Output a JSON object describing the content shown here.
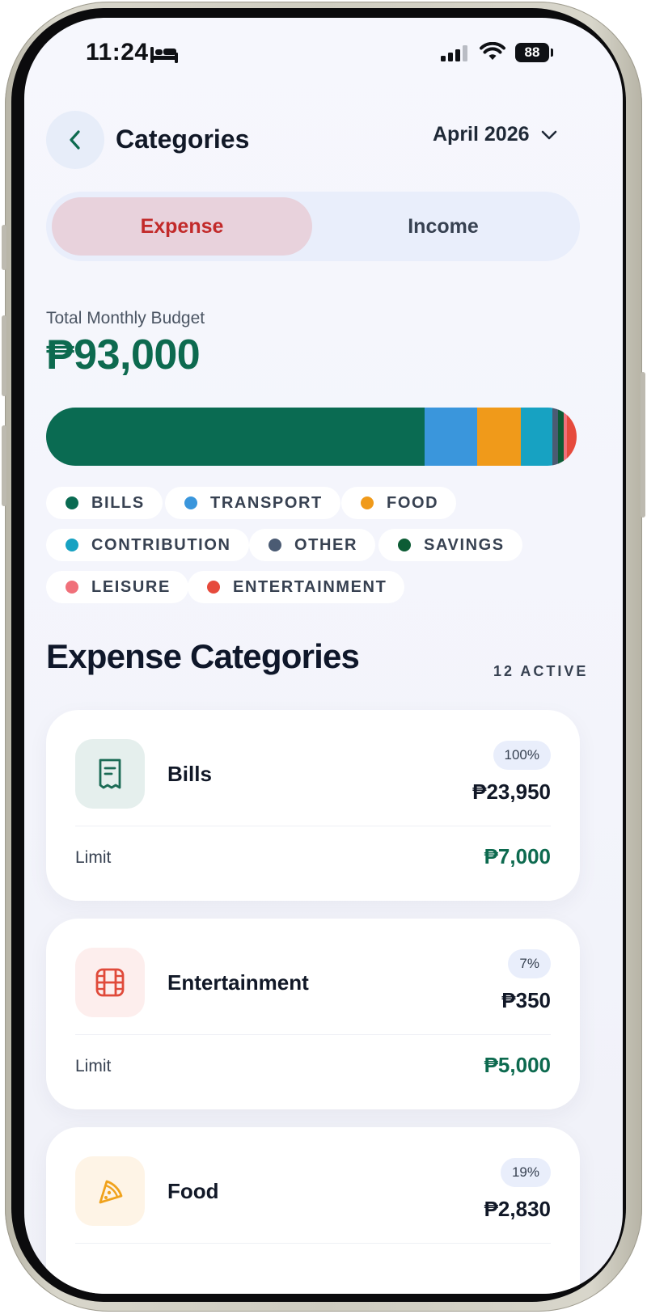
{
  "status_bar": {
    "time": "11:24",
    "battery": "88"
  },
  "header": {
    "title": "Categories",
    "month": "April 2026"
  },
  "toggle": {
    "expense_label": "Expense",
    "income_label": "Income",
    "selected": "Expense"
  },
  "budget": {
    "label": "Total Monthly Budget",
    "amount": "₱93,000",
    "bar_segments": [
      {
        "category": "BILLS",
        "share": 0.713,
        "color": "#0a6b52"
      },
      {
        "category": "TRANSPORT",
        "share": 0.1,
        "color": "#3a96dc"
      },
      {
        "category": "FOOD",
        "share": 0.082,
        "color": "#f09a1a"
      },
      {
        "category": "CONTRIBUTION",
        "share": 0.06,
        "color": "#17a2c2"
      },
      {
        "category": "OTHER",
        "share": 0.01,
        "color": "#4b5b73"
      },
      {
        "category": "SAVINGS",
        "share": 0.01,
        "color": "#0d5c35"
      },
      {
        "category": "LEISURE",
        "share": 0.007,
        "color": "#f0707a"
      },
      {
        "category": "ENTERTAINMENT",
        "share": 0.018,
        "color": "#e64a3c"
      }
    ]
  },
  "legend": [
    {
      "label": "BILLS",
      "color": "#0a6b52"
    },
    {
      "label": "TRANSPORT",
      "color": "#3a96dc"
    },
    {
      "label": "FOOD",
      "color": "#f09a1a"
    },
    {
      "label": "CONTRIBUTION",
      "color": "#17a2c2"
    },
    {
      "label": "OTHER",
      "color": "#4b5b73"
    },
    {
      "label": "SAVINGS",
      "color": "#0d5c35"
    },
    {
      "label": "LEISURE",
      "color": "#f0707a"
    },
    {
      "label": "ENTERTAINMENT",
      "color": "#e64a3c"
    }
  ],
  "section": {
    "title": "Expense Categories",
    "active_count": "12 ACTIVE"
  },
  "categories": [
    {
      "name": "Bills",
      "icon": "receipt-icon",
      "icon_color": "#1b6b55",
      "icon_bg": "#e5efed",
      "percent": "100%",
      "spent": "₱23,950",
      "limit_label": "Limit",
      "limit": "₱7,000"
    },
    {
      "name": "Entertainment",
      "icon": "film-icon",
      "icon_color": "#e04a3a",
      "icon_bg": "#fdeeed",
      "percent": "7%",
      "spent": "₱350",
      "limit_label": "Limit",
      "limit": "₱5,000"
    },
    {
      "name": "Food",
      "icon": "pizza-icon",
      "icon_color": "#f0a21c",
      "icon_bg": "#fef4e6",
      "percent": "19%",
      "spent": "₱2,830",
      "limit_label": "Limit",
      "limit": ""
    }
  ]
}
